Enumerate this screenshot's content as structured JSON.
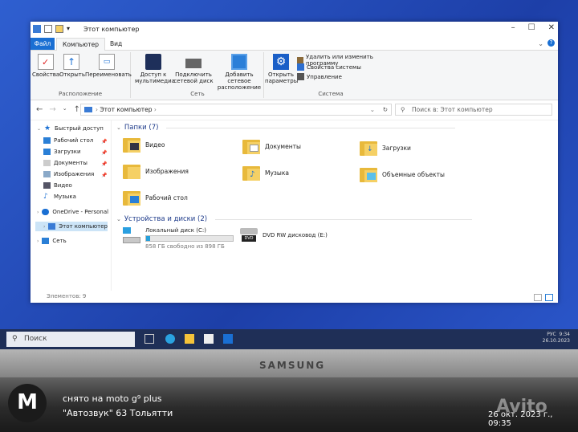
{
  "window": {
    "title": "Этот компьютер",
    "controls": [
      "–",
      "☐",
      "✕"
    ]
  },
  "tabs": {
    "file": "Файл",
    "computer": "Компьютер",
    "view": "Вид"
  },
  "ribbon": {
    "location": {
      "label": "Расположение",
      "properties": "Свойства",
      "open": "Открыть",
      "rename": "Переименовать"
    },
    "network": {
      "label": "Сеть",
      "media_line1": "Доступ к",
      "media_line2": "мультимедиа",
      "map_line1": "Подключить",
      "map_line2": "сетевой диск",
      "add_line1": "Добавить сетевое",
      "add_line2": "расположение"
    },
    "system": {
      "label": "Система",
      "settings_line1": "Открыть",
      "settings_line2": "параметры",
      "uninstall": "Удалить или изменить программу",
      "sys_props": "Свойства системы",
      "manage": "Управление"
    }
  },
  "address": {
    "path": "Этот компьютер",
    "search_placeholder": "Поиск в: Этот компьютер"
  },
  "sidebar": {
    "quick_access": "Быстрый доступ",
    "items": [
      "Рабочий стол",
      "Загрузки",
      "Документы",
      "Изображения",
      "Видео",
      "Музыка"
    ],
    "onedrive": "OneDrive - Personal",
    "this_pc": "Этот компьютер",
    "network": "Сеть"
  },
  "folders": {
    "header": "Папки (7)",
    "items": [
      "Видео",
      "Документы",
      "Загрузки",
      "Изображения",
      "Музыка",
      "Объемные объекты",
      "Рабочий стол"
    ]
  },
  "drives": {
    "header": "Устройства и диски (2)",
    "local_name": "Локальный диск (C:)",
    "local_free": "858 ГБ свободно из 898 ГБ",
    "local_used_fraction": 0.045,
    "dvd_name": "DVD RW дисковод (E:)"
  },
  "status": "Элементов: 9",
  "taskbar": {
    "search": "Поиск",
    "lang": "РУС",
    "time": "9:34",
    "date": "26.10.2023"
  },
  "photo": {
    "brand": "SAMSUNG",
    "caption_line1": "снято на moto g⁹ plus",
    "caption_line2": "\"Автозвук\" 63 Тольятти",
    "watermark_date": "26 окт. 2023 г., 09:35",
    "avito": "Avito"
  },
  "colors": {
    "accent": "#1a6fd3",
    "folder": "#e8b93b",
    "desktop": "#2f5fd0"
  }
}
